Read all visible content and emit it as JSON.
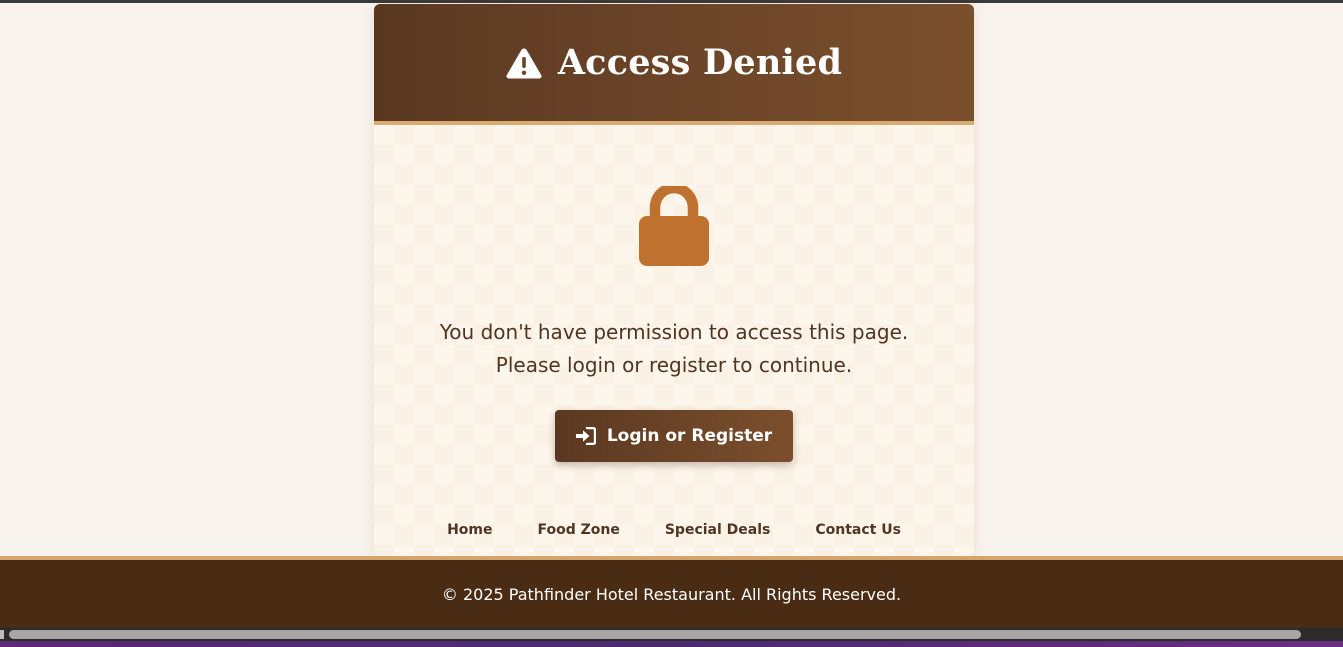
{
  "header": {
    "icon": "warning-triangle-icon",
    "title": "Access Denied"
  },
  "body": {
    "icon": "lock-icon",
    "message_line1": "You don't have permission to access this page.",
    "message_line2": "Please login or register to continue."
  },
  "login_button": {
    "icon": "sign-in-icon",
    "label": "Login or Register"
  },
  "nav": {
    "items": [
      {
        "label": "Home"
      },
      {
        "label": "Food Zone"
      },
      {
        "label": "Special Deals"
      },
      {
        "label": "Contact Us"
      }
    ]
  },
  "footer": {
    "copyright": "© 2025 Pathfinder Hotel Restaurant. All Rights Reserved."
  },
  "colors": {
    "header_brown": "#6b4428",
    "accent_gold": "#d8ab70",
    "lock_orange": "#bf7230",
    "footer_brown": "#4a2b14",
    "page_background": "#f8f3ec"
  }
}
